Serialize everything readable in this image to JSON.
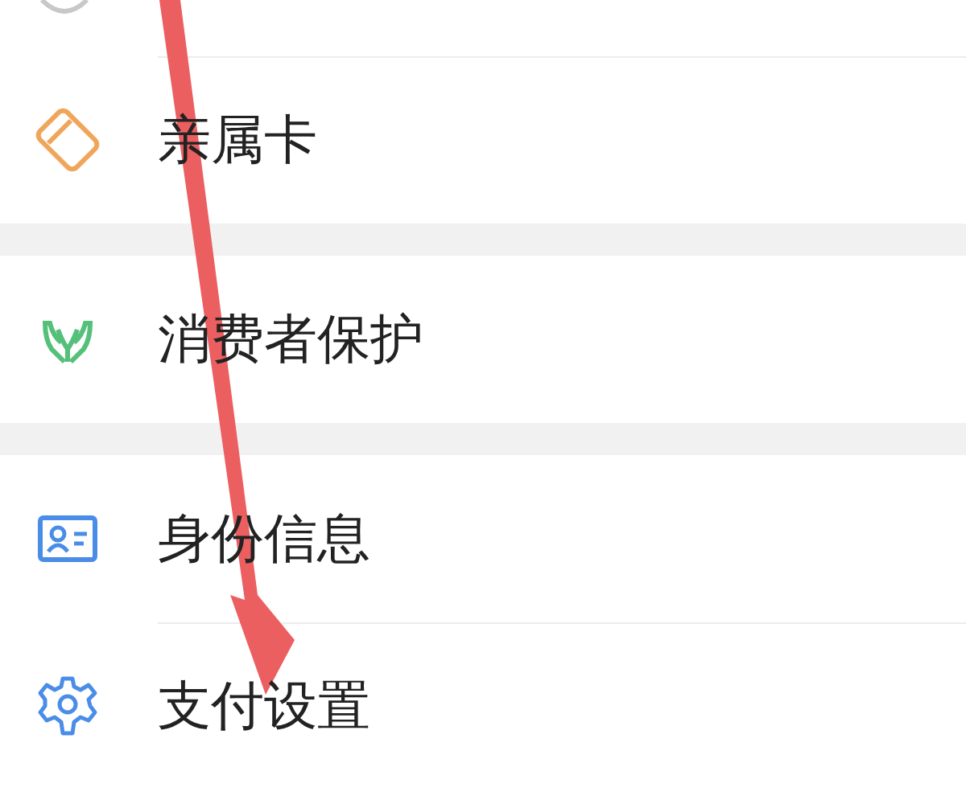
{
  "groups": [
    {
      "items": [
        {
          "kind": "card",
          "label": "亲属卡"
        }
      ]
    },
    {
      "items": [
        {
          "kind": "hands",
          "label": "消费者保护"
        }
      ]
    },
    {
      "items": [
        {
          "kind": "idcard",
          "label": "身份信息"
        },
        {
          "kind": "gear",
          "label": "支付设置"
        }
      ]
    }
  ]
}
